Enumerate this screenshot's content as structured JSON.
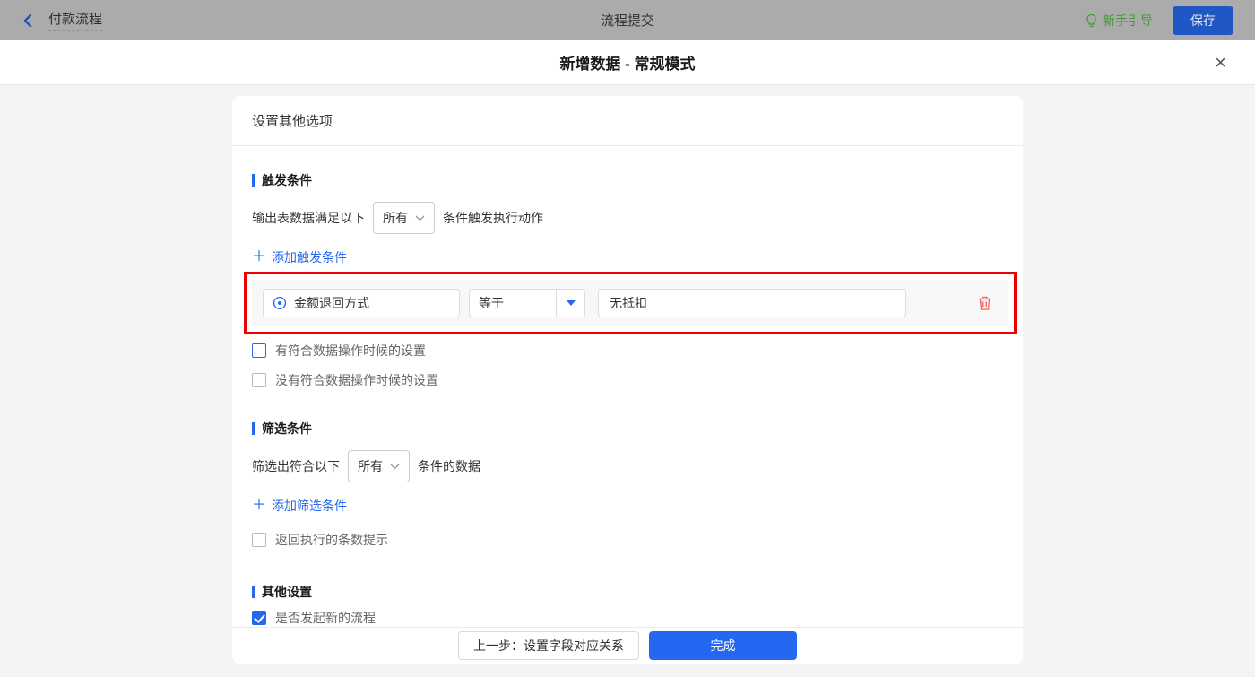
{
  "topbar": {
    "back_label": "付款流程",
    "center_title": "流程提交",
    "guide_label": "新手引导",
    "save_label": "保存"
  },
  "modal": {
    "title": "新增数据 - 常规模式",
    "close_glyph": "×"
  },
  "card": {
    "header": "设置其他选项",
    "trigger": {
      "title": "触发条件",
      "sentence_prefix": "输出表数据满足以下",
      "match_select": "所有",
      "sentence_suffix": "条件触发执行动作",
      "add_link": "添加触发条件",
      "condition": {
        "field": "金额退回方式",
        "operator": "等于",
        "value": "无抵扣"
      },
      "checkboxes": [
        {
          "label": "有符合数据操作时候的设置",
          "checked": false
        },
        {
          "label": "没有符合数据操作时候的设置",
          "checked": false
        }
      ]
    },
    "filter": {
      "title": "筛选条件",
      "sentence_prefix": "筛选出符合以下",
      "match_select": "所有",
      "sentence_suffix": "条件的数据",
      "add_link": "添加筛选条件",
      "checkbox": {
        "label": "返回执行的条数提示",
        "checked": false
      }
    },
    "other": {
      "title": "其他设置",
      "checkbox": {
        "label": "是否发起新的流程",
        "checked": true
      }
    },
    "footer": {
      "prev_label": "上一步：设置字段对应关系",
      "done_label": "完成"
    }
  },
  "icons": {
    "plus": "＋"
  },
  "colors": {
    "accent": "#2468f2",
    "highlight_red": "#ec0000",
    "danger": "#f05b5b",
    "guide_green": "#3f9a2f"
  }
}
